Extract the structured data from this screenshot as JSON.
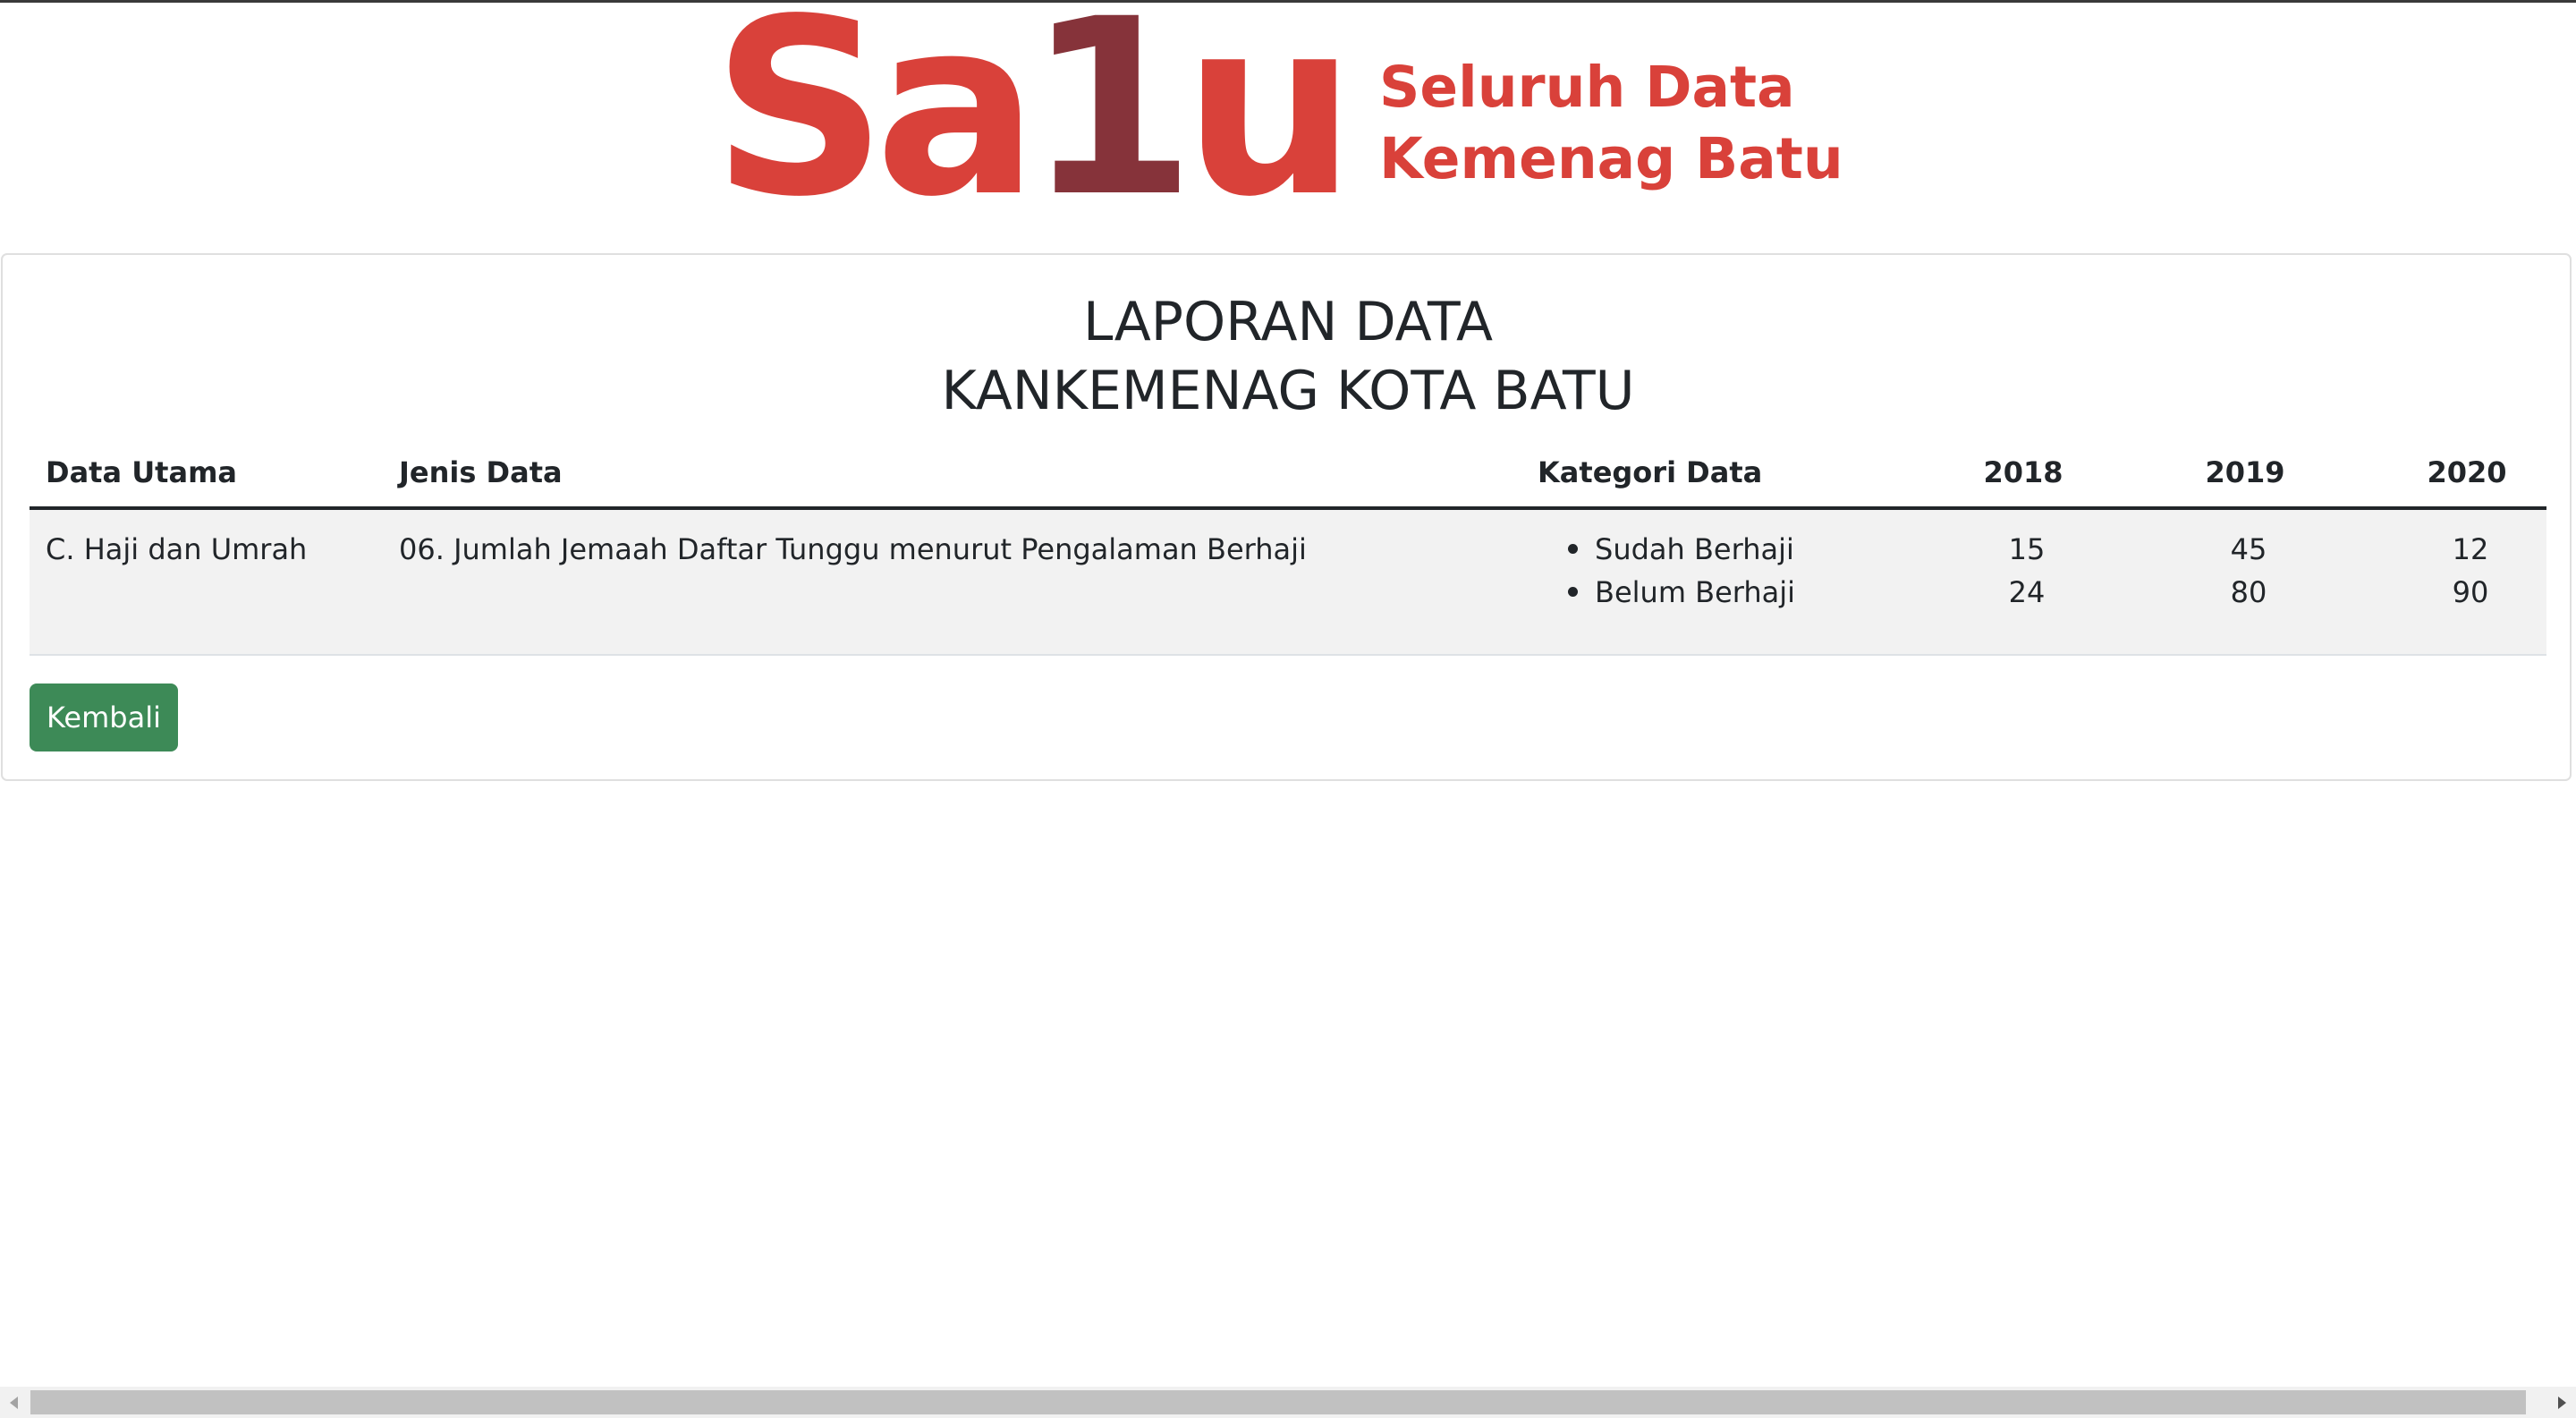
{
  "logo": {
    "word_part1": "Sa",
    "word_part2": "1",
    "word_part3": "u",
    "tagline_line1": "Seluruh Data",
    "tagline_line2": "Kemenag Batu",
    "colors": {
      "primary": "#d9413a",
      "secondary": "#86333a"
    }
  },
  "report": {
    "title_line1": "LAPORAN DATA",
    "title_line2": "KANKEMENAG KOTA BATU"
  },
  "table": {
    "headers": {
      "data_utama": "Data Utama",
      "jenis_data": "Jenis Data",
      "kategori_data": "Kategori Data",
      "y2018": "2018",
      "y2019": "2019",
      "y2020": "2020"
    },
    "rows": [
      {
        "data_utama": "C. Haji dan Umrah",
        "jenis_data": "06. Jumlah Jemaah Daftar Tunggu menurut Pengalaman Berhaji",
        "kategori": [
          {
            "label": "Sudah Berhaji",
            "y2018": "15",
            "y2019": "45",
            "y2020": "12"
          },
          {
            "label": "Belum Berhaji",
            "y2018": "24",
            "y2019": "80",
            "y2020": "90"
          }
        ]
      }
    ]
  },
  "actions": {
    "back_label": "Kembali",
    "back_color": "#3d8a57"
  }
}
